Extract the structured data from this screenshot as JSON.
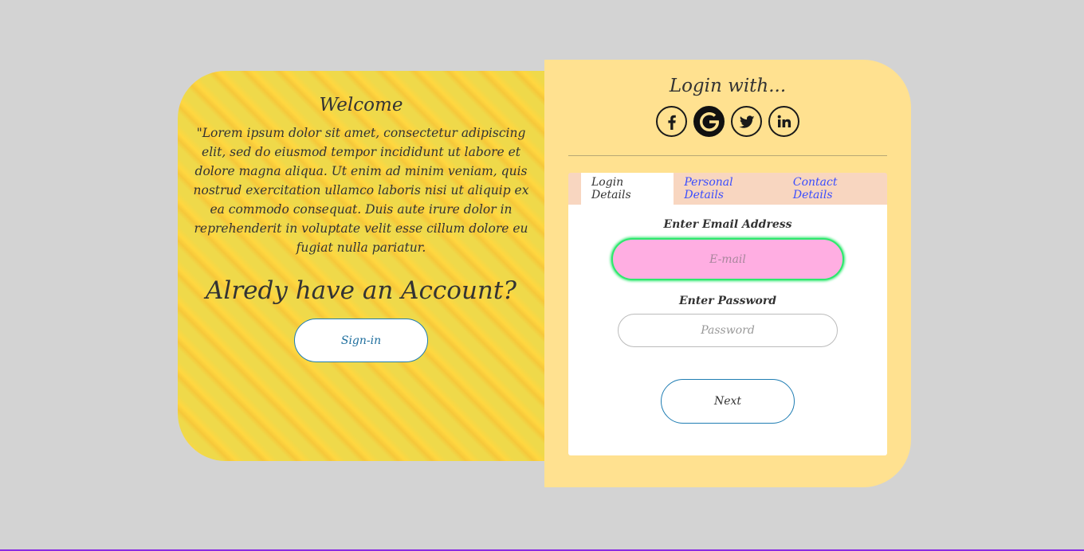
{
  "welcome": {
    "title": "Welcome",
    "text": "\"Lorem ipsum dolor sit amet, consectetur adipiscing elit, sed do eiusmod tempor incididunt ut labore et dolore magna aliqua. Ut enim ad minim veniam, quis nostrud exercitation ullamco laboris nisi ut aliquip ex ea commodo consequat. Duis aute irure dolor in reprehenderit in voluptate velit esse cillum dolore eu fugiat nulla pariatur.",
    "account_heading": "Alredy have an Account?",
    "signin_label": "Sign-in"
  },
  "login": {
    "heading": "Login with...",
    "social": [
      {
        "icon": "facebook-icon",
        "glyph": "f"
      },
      {
        "icon": "google-icon",
        "glyph": "G"
      },
      {
        "icon": "twitter-icon",
        "glyph": "🐦"
      },
      {
        "icon": "linkedin-icon",
        "glyph": "in"
      }
    ],
    "tabs": [
      {
        "label": "Login Details",
        "active": true
      },
      {
        "label": "Personal Details",
        "active": false
      },
      {
        "label": "Contact Details",
        "active": false
      }
    ],
    "email_label": "Enter Email Address",
    "email_placeholder": "E-mail",
    "email_value": "",
    "password_label": "Enter Password",
    "password_placeholder": "Password",
    "password_value": "",
    "next_label": "Next"
  },
  "colors": {
    "background": "#d3d3d3",
    "right_panel": "#ffe190",
    "email_field": "#ffaee2",
    "focus_ring": "#2ee86e",
    "tab_link": "#3a4dff",
    "button_border": "#1f7db3"
  }
}
